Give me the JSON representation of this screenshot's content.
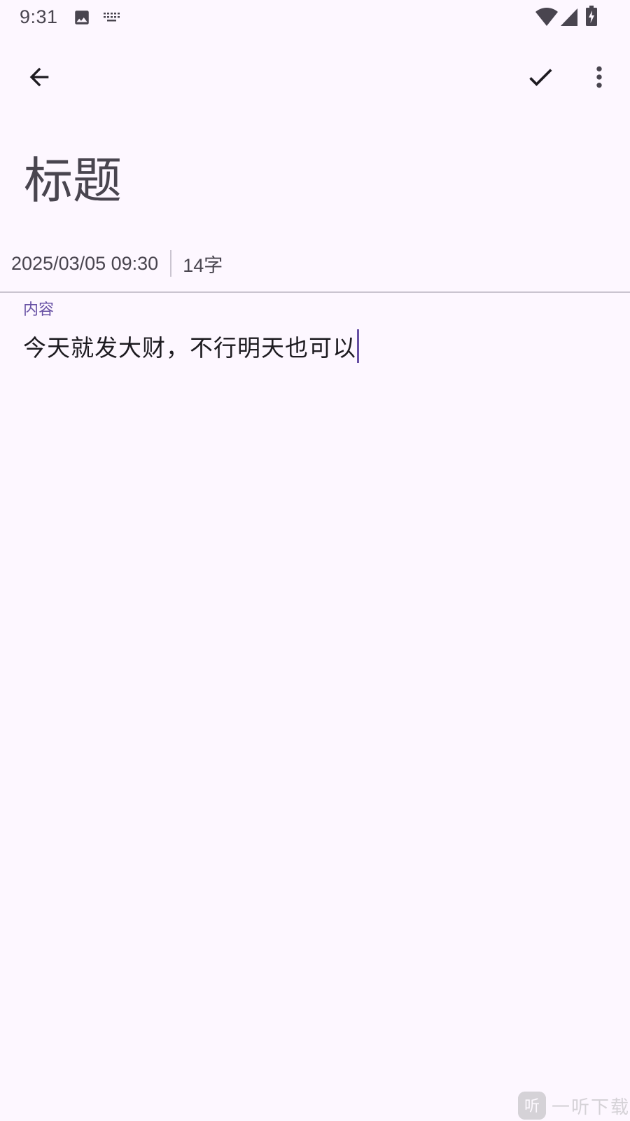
{
  "status_bar": {
    "time": "9:31",
    "icons": [
      "image-icon",
      "keyboard-icon",
      "wifi-icon",
      "signal-icon",
      "battery-charging-icon"
    ]
  },
  "app_bar": {
    "back_icon": "arrow-back-icon",
    "confirm_icon": "check-icon",
    "more_icon": "more-vert-icon"
  },
  "note": {
    "title": "标题",
    "datetime": "2025/03/05 09:30",
    "word_count": "14字",
    "content_label": "内容",
    "content": "今天就发大财，不行明天也可以"
  },
  "watermark": {
    "text": "一听下载",
    "logo_char": "听"
  },
  "colors": {
    "background": "#FDF7FF",
    "primary": "#6750A4",
    "on_surface": "#1D1B20",
    "on_surface_variant": "#49454F",
    "outline_variant": "#CAC4D0"
  }
}
